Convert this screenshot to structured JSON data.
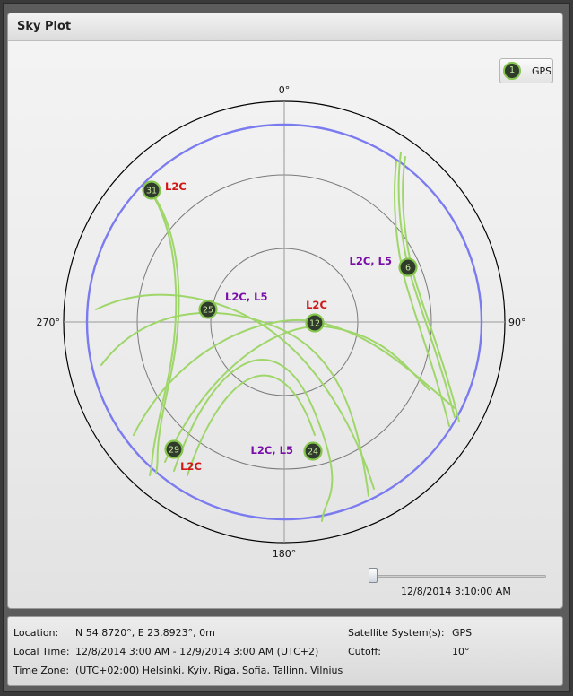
{
  "panel": {
    "title": "Sky Plot"
  },
  "legend": {
    "marker": "1",
    "label": "GPS",
    "marker_color": "#86c54e"
  },
  "plot": {
    "direction_labels": {
      "north": "0°",
      "east": "90°",
      "south": "180°",
      "west": "270°"
    },
    "colors": {
      "horizon": "#7b7bf0",
      "track": "#9fd66a",
      "sat_fill": "#2f3b2b",
      "sat_stroke": "#86c54e",
      "red": "#d01616",
      "purple": "#7a0ea8"
    },
    "satellites": [
      {
        "prn": "31",
        "signals": "L2C",
        "color": "red"
      },
      {
        "prn": "6",
        "signals": "L2C, L5",
        "color": "purple"
      },
      {
        "prn": "25",
        "signals": "L2C, L5",
        "color": "purple"
      },
      {
        "prn": "12",
        "signals": "L2C",
        "color": "red"
      },
      {
        "prn": "29",
        "signals": "L2C",
        "color": "red"
      },
      {
        "prn": "24",
        "signals": "L2C, L5",
        "color": "purple"
      }
    ]
  },
  "slider": {
    "time": "12/8/2014 3:10:00 AM",
    "position": 0.0
  },
  "info": {
    "location_label": "Location:",
    "location_value": "N 54.8720°, E 23.8923°, 0m",
    "local_time_label": "Local Time:",
    "local_time_value": "12/8/2014 3:00 AM - 12/9/2014 3:00 AM (UTC+2)",
    "time_zone_label": "Time Zone:",
    "time_zone_value": "(UTC+02:00) Helsinki, Kyiv, Riga, Sofia, Tallinn, Vilnius",
    "satellite_system_label": "Satellite System(s):",
    "satellite_system_value": "GPS",
    "cutoff_label": "Cutoff:",
    "cutoff_value": "10°"
  }
}
